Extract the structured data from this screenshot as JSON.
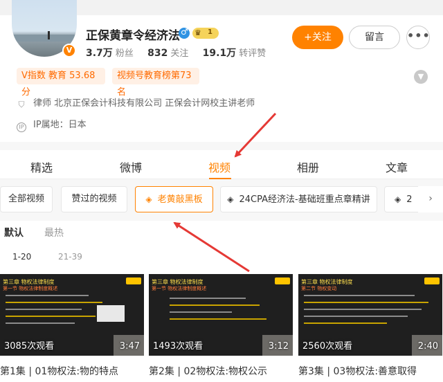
{
  "profile": {
    "name": "正保黄章令经济法",
    "level_badge": "1",
    "stats": [
      {
        "value": "3.7万",
        "label": "粉丝"
      },
      {
        "value": "832",
        "label": "关注"
      },
      {
        "value": "19.1万",
        "label": "转评赞"
      }
    ],
    "follow_label": "+关注",
    "message_label": "留言",
    "more_label": "•••",
    "tags": [
      "V指数 教育 53.68分",
      "视频号教育榜第73名"
    ],
    "info": {
      "lawyer": "律师 北京正保会计科技有限公司 正保会计网校主讲老师",
      "ip": "IP属地：日本",
      "ip_icon_text": "IP"
    },
    "verified_mark": "V"
  },
  "tabs": [
    {
      "label": "精选"
    },
    {
      "label": "微博"
    },
    {
      "label": "视频"
    },
    {
      "label": "相册"
    },
    {
      "label": "文章"
    }
  ],
  "filters": [
    {
      "label": "全部视频"
    },
    {
      "label": "赞过的视频"
    },
    {
      "label": "老黄敲黑板"
    },
    {
      "label": "24CPA经济法-基础班重点章精讲"
    },
    {
      "label": "2"
    }
  ],
  "sort": {
    "default": "默认",
    "hot": "最热"
  },
  "ranges": [
    "1-20",
    "21-39"
  ],
  "videos": [
    {
      "title": "第1集 | 01物权法:物的特点",
      "views": "3085次观看",
      "duration": "3:47",
      "slide_header": "第三章 物权法律制度",
      "slide_sub": "第一节 物权法律制度概述"
    },
    {
      "title": "第2集 | 02物权法:物权公示",
      "views": "1493次观看",
      "duration": "3:12",
      "slide_header": "第三章 物权法律制度",
      "slide_sub": "第一节 物权法律制度概述"
    },
    {
      "title": "第3集 | 03物权法:善意取得",
      "views": "2560次观看",
      "duration": "2:40",
      "slide_header": "第三章 物权法律制度",
      "slide_sub": "第二节 物权变动"
    }
  ],
  "colors": {
    "accent": "#ff8200",
    "tag_bg": "#fff0e5",
    "arrow": "#e53935"
  }
}
